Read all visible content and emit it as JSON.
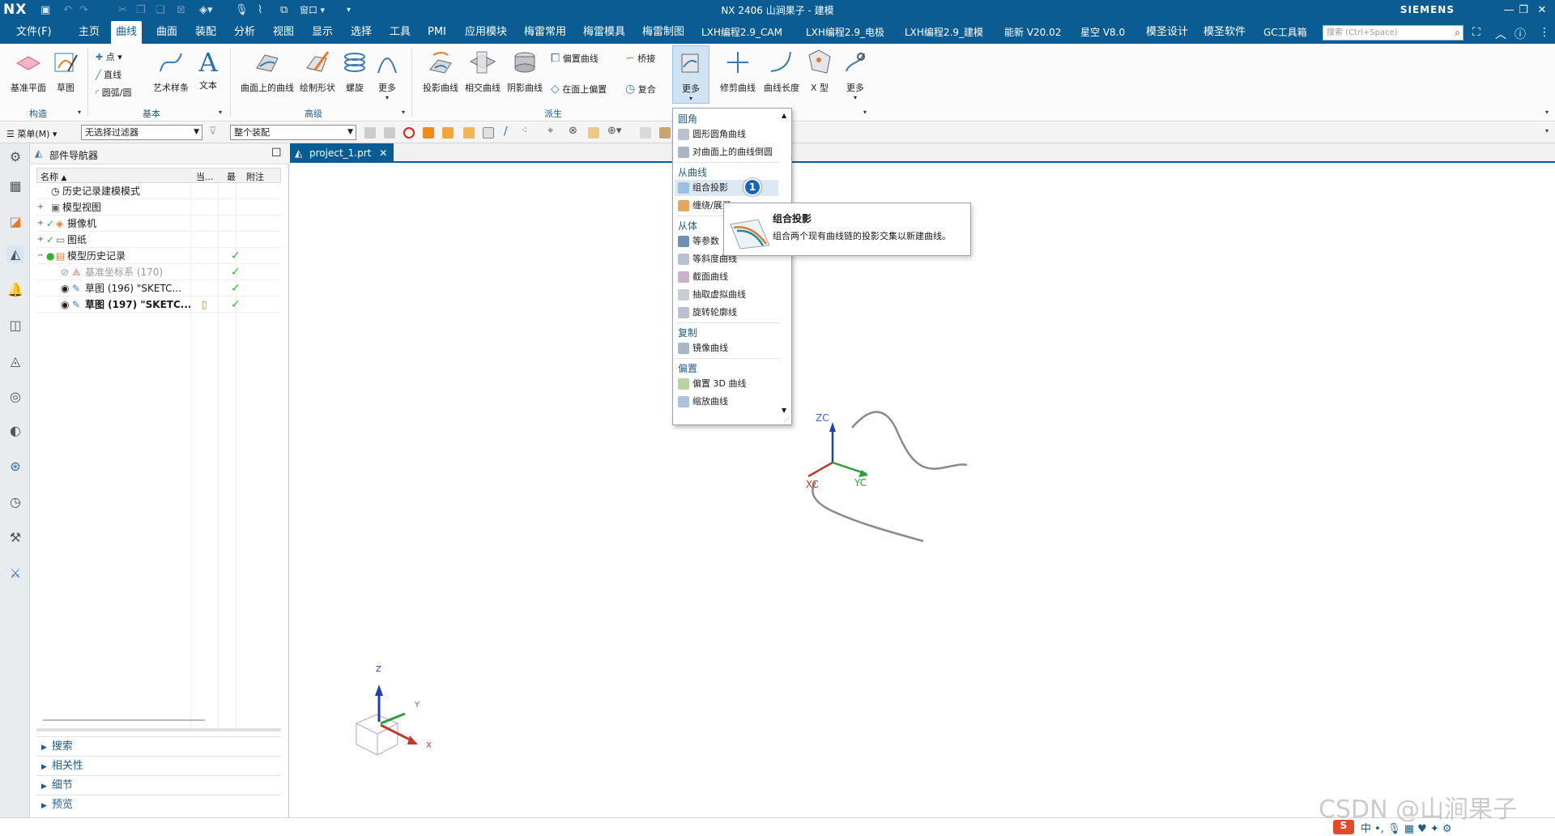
{
  "app": {
    "logo": "NX",
    "title": "NX 2406 山涧果子 - 建模",
    "brand": "SIEMENS",
    "window_menu": "窗口"
  },
  "menubar": {
    "file": "文件(F)",
    "tabs": [
      "主页",
      "曲线",
      "曲面",
      "装配",
      "分析",
      "视图",
      "显示",
      "选择",
      "工具",
      "PMI",
      "应用模块",
      "梅雷常用",
      "梅雷模具",
      "梅雷制图",
      "LXH编程2.9_CAM",
      "LXH编程2.9_电极",
      "LXH编程2.9_建模",
      "能新 V20.02",
      "星空 V8.0",
      "模圣设计",
      "模圣软件",
      "GC工具箱"
    ],
    "active_tab": "曲线",
    "search_placeholder": "搜索 (Ctrl+Space)"
  },
  "ribbon": {
    "groups": {
      "construct": "构造",
      "basic": "基本",
      "advanced": "高级",
      "derived": "派生"
    },
    "buttons": {
      "datum_plane": "基准平面",
      "sketch": "草图",
      "point": "点",
      "line": "直线",
      "arc": "圆弧/圆",
      "studio_spline": "艺术样条",
      "text": "文本",
      "curve_on_surface": "曲面上的曲线",
      "draw_shape": "绘制形状",
      "helix": "螺旋",
      "more_adv": "更多",
      "project_curve": "投影曲线",
      "intersection_curve": "相交曲线",
      "silhouette_curve": "阴影曲线",
      "offset_curve": "偏置曲线",
      "bridge": "桥接",
      "offset_in_face": "在面上偏置",
      "composite": "复合",
      "more_derived": "更多",
      "trim_curve": "修剪曲线",
      "curve_length": "曲线长度",
      "x_form": "X 型",
      "more_edit": "更多"
    }
  },
  "selbar": {
    "menu": "菜单(M)",
    "filter": "无选择过滤器",
    "scope": "整个装配"
  },
  "navigator": {
    "title": "部件导航器",
    "columns": [
      "名称",
      "当...",
      "最",
      "附注"
    ],
    "rows": [
      {
        "label": "历史记录建模模式"
      },
      {
        "label": "模型视图"
      },
      {
        "label": "摄像机"
      },
      {
        "label": "图纸"
      },
      {
        "label": "模型历史记录"
      },
      {
        "label": "基准坐标系 (170)"
      },
      {
        "label": "草图 (196) \"SKETC..."
      },
      {
        "label": "草图 (197) \"SKETC..."
      }
    ],
    "sections": [
      "搜索",
      "相关性",
      "细节",
      "预览"
    ]
  },
  "graphics": {
    "tab_label": "project_1.prt",
    "axes": {
      "zc": "ZC",
      "xc": "XC",
      "yc": "YC",
      "z": "Z",
      "x": "X",
      "y": "Y"
    }
  },
  "dropdown": {
    "sections": [
      {
        "header": "圆角",
        "items": [
          "圆形圆角曲线",
          "对曲面上的曲线倒圆"
        ]
      },
      {
        "header": "从曲线",
        "items": [
          "组合投影",
          "缠绕/展开"
        ]
      },
      {
        "header": "从体",
        "items": [
          "等参数",
          "等斜度曲线",
          "截面曲线",
          "抽取虚拟曲线",
          "旋转轮廓线"
        ]
      },
      {
        "header": "复制",
        "items": [
          "镜像曲线"
        ]
      },
      {
        "header": "偏置",
        "items": [
          "偏置 3D 曲线",
          "缩放曲线"
        ]
      }
    ],
    "highlighted": "组合投影",
    "badge": "1"
  },
  "tooltip": {
    "title": "组合投影",
    "body": "组合两个现有曲线链的投影交集以新建曲线。"
  },
  "watermark": "CSDN @山涧果子",
  "colors": {
    "brand_blue": "#0b5c92",
    "accent": "#1f5c8c",
    "check_green": "#2fb52f"
  }
}
